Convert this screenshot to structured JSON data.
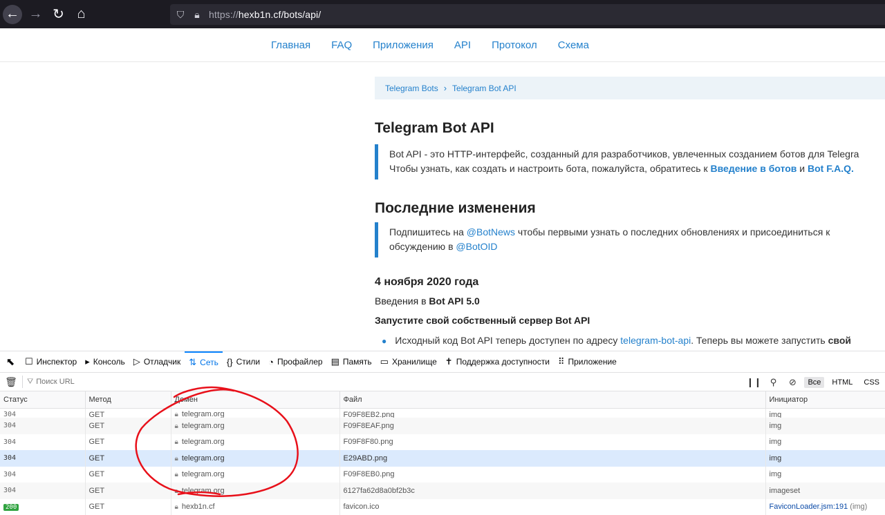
{
  "browser": {
    "url_scheme": "https://",
    "url_host_path": "hexb1n.cf/bots/api/"
  },
  "site_nav": [
    "Главная",
    "FAQ",
    "Приложения",
    "API",
    "Протокол",
    "Схема"
  ],
  "breadcrumb": {
    "first": "Telegram Bots",
    "second": "Telegram Bot API"
  },
  "page": {
    "title": "Telegram Bot API",
    "intro_line1": "Bot API - это HTTP-интерфейс, созданный для разработчиков, увлеченных созданием ботов для Telegra",
    "intro_line2_prefix": "Чтобы узнать, как создать и настроить бота, пожалуйста, обратитесь к ",
    "intro_link1": "Введение в ботов",
    "intro_and": " и ",
    "intro_link2": "Bot F.A.Q.",
    "recent_title": "Последние изменения",
    "recent_prefix": "Подпишитесь на ",
    "recent_link1": "@BotNews",
    "recent_mid": " чтобы первыми узнать о последних обновлениях и присоединиться к",
    "recent_line2_prefix": "обсуждению в ",
    "recent_link2": "@BotOID",
    "date_heading": "4 ноября 2020 года",
    "intro_version_prefix": "Введения в ",
    "intro_version": "Bot API 5.0",
    "server_heading": "Запустите свой собственный сервер Bot API",
    "bullet_prefix": "Исходный код Bot API теперь доступен по адресу ",
    "bullet_link": "telegram-bot-api",
    "bullet_suffix": ". Теперь вы можете запустить ",
    "bullet_bold": "свой"
  },
  "devtools": {
    "tabs": [
      {
        "icon": "☐",
        "label": "Инспектор",
        "name": "inspector"
      },
      {
        "icon": "▸",
        "label": "Консоль",
        "name": "console"
      },
      {
        "icon": "▷",
        "label": "Отладчик",
        "name": "debugger"
      },
      {
        "icon": "⇅",
        "label": "Сеть",
        "name": "network"
      },
      {
        "icon": "{}",
        "label": "Стили",
        "name": "styles"
      },
      {
        "icon": "◔",
        "label": "Профайлер",
        "name": "profiler"
      },
      {
        "icon": "▤",
        "label": "Память",
        "name": "memory"
      },
      {
        "icon": "▭",
        "label": "Хранилище",
        "name": "storage"
      },
      {
        "icon": "✝",
        "label": "Поддержка доступности",
        "name": "accessibility"
      },
      {
        "icon": "⠿",
        "label": "Приложение",
        "name": "application"
      }
    ],
    "filter_placeholder": "Поиск URL",
    "type_filters": [
      "Все",
      "HTML",
      "CSS"
    ],
    "columns": [
      "Статус",
      "Метод",
      "Домен",
      "Файл",
      "Инициатор"
    ],
    "rows": [
      {
        "status": "304",
        "method": "GET",
        "domain": "telegram.org",
        "file": "F09F8EB2.png",
        "initiator": "img",
        "partial": true
      },
      {
        "status": "304",
        "method": "GET",
        "domain": "telegram.org",
        "file": "F09F8EAF.png",
        "initiator": "img"
      },
      {
        "status": "304",
        "method": "GET",
        "domain": "telegram.org",
        "file": "F09F8F80.png",
        "initiator": "img"
      },
      {
        "status": "304",
        "method": "GET",
        "domain": "telegram.org",
        "file": "E29ABD.png",
        "initiator": "img",
        "selected": true
      },
      {
        "status": "304",
        "method": "GET",
        "domain": "telegram.org",
        "file": "F09F8EB0.png",
        "initiator": "img"
      },
      {
        "status": "304",
        "method": "GET",
        "domain": "telegram.org",
        "file": "6127fa62d8a0bf2b3c",
        "initiator": "imageset"
      },
      {
        "status": "200",
        "method": "GET",
        "domain": "hexb1n.cf",
        "file": "favicon.ico",
        "initiator_link": "FaviconLoader.jsm:191",
        "initiator_suffix": " (img)"
      }
    ]
  },
  "colors": {
    "accent": "#2481cc",
    "annotation": "#e8101a",
    "active_tab": "#0074e8"
  }
}
